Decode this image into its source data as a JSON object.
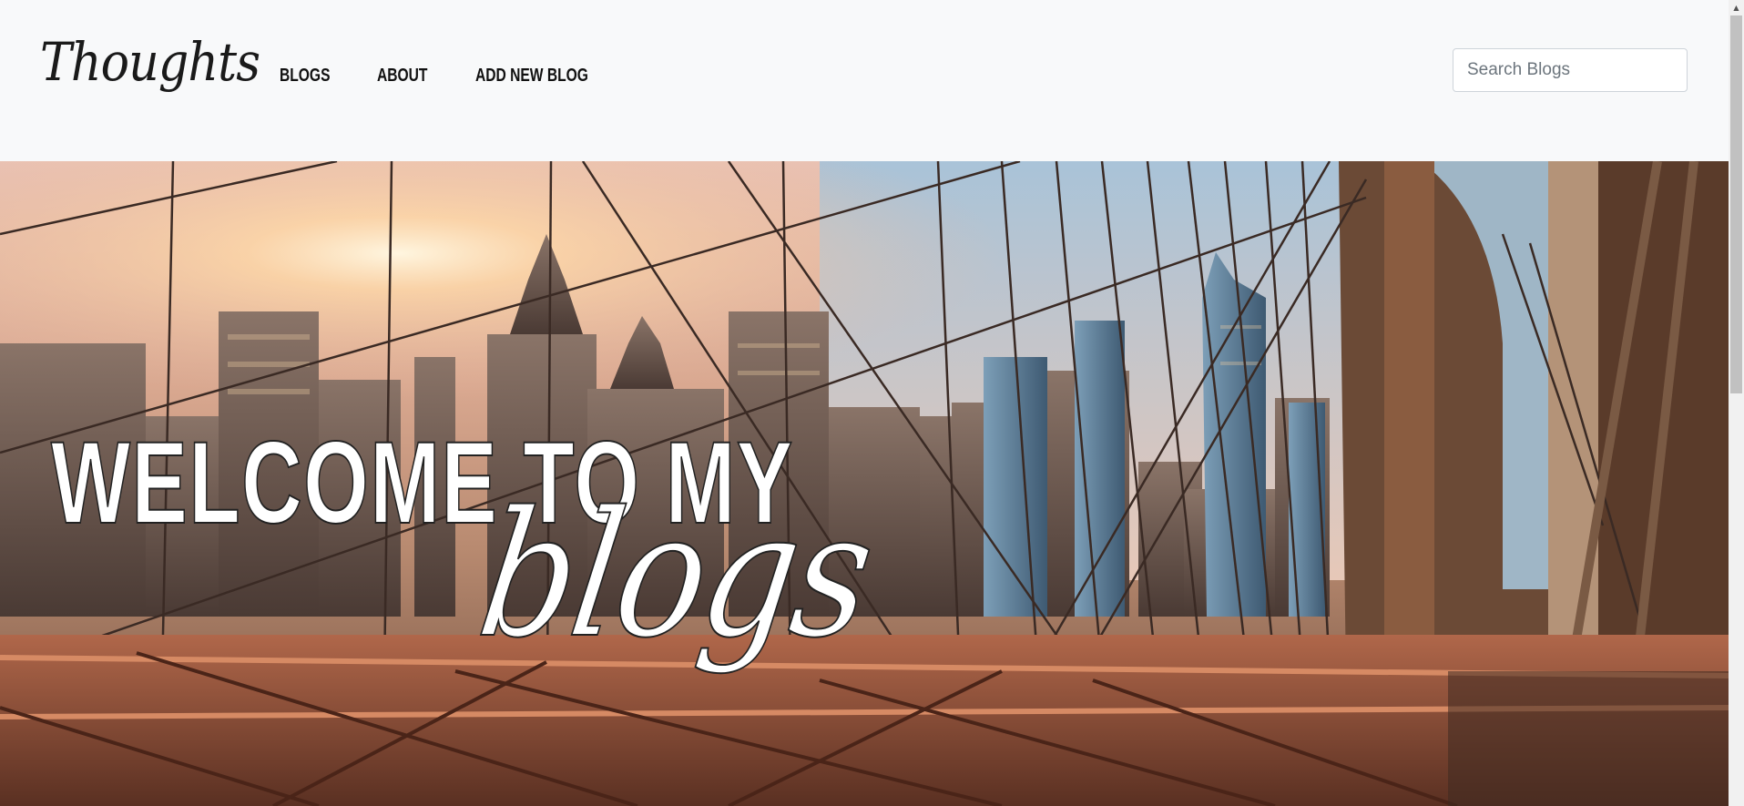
{
  "navbar": {
    "brand": "Thoughts",
    "links": [
      {
        "label": "Blogs"
      },
      {
        "label": "About"
      },
      {
        "label": "Add New Blog"
      }
    ],
    "search": {
      "placeholder": "Search Blogs",
      "value": ""
    }
  },
  "hero": {
    "title": "WELCOME TO MY",
    "subtitle": "blogs",
    "image": "brooklyn-bridge-skyline-photo"
  },
  "colors": {
    "navbar_bg": "#f8f9fa",
    "hero_text": "#ffffff",
    "text_outline": "#222222"
  },
  "scrollbar": {
    "up_arrow_icon": "chevron-up-icon"
  }
}
